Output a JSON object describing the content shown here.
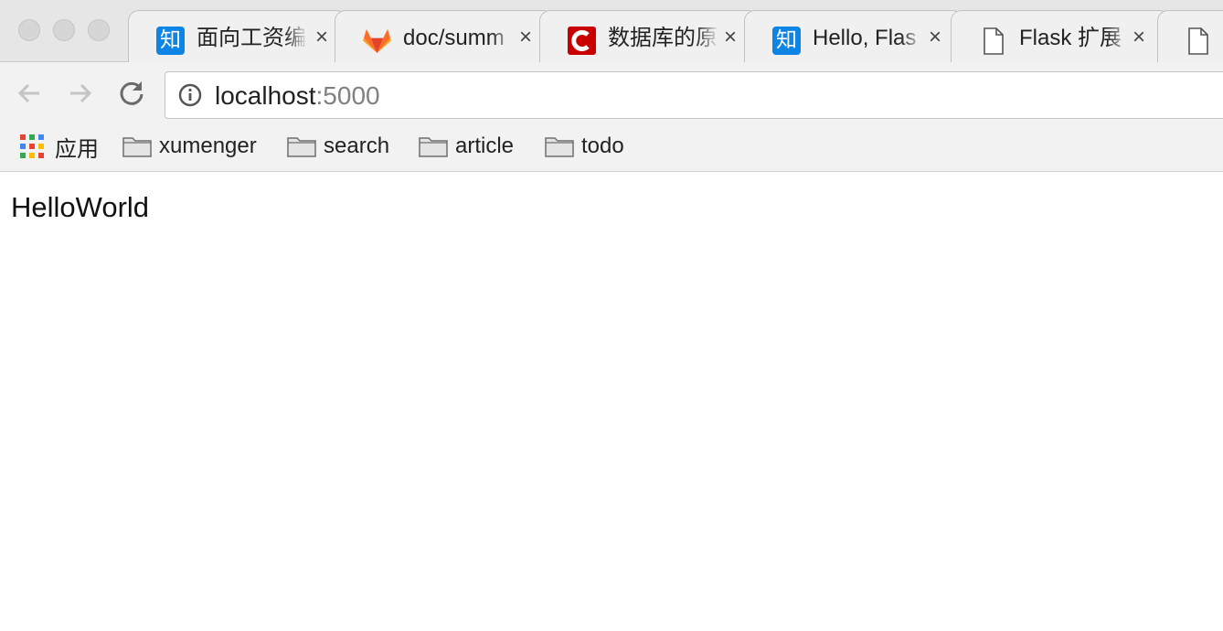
{
  "browser": {
    "tabs": [
      {
        "title": "面向工资编",
        "icon": "zhihu-icon"
      },
      {
        "title": "doc/summ",
        "icon": "gitlab-icon"
      },
      {
        "title": "数据库的原",
        "icon": "csdn-icon"
      },
      {
        "title": "Hello, Flas",
        "icon": "zhihu-icon"
      },
      {
        "title": "Flask 扩展",
        "icon": "document-icon"
      },
      {
        "title": "",
        "icon": "document-icon"
      }
    ],
    "favicon_zhihu": "知",
    "address": {
      "host": "localhost",
      "port": ":5000"
    },
    "bookmarks": {
      "apps_label": "应用",
      "folders": [
        "xumenger",
        "search",
        "article",
        "todo"
      ]
    }
  },
  "page": {
    "text": "HelloWorld"
  },
  "colors": {
    "zhihu": "#0e84e4",
    "csdn": "#c90000",
    "gitlab": "#e2432a"
  }
}
